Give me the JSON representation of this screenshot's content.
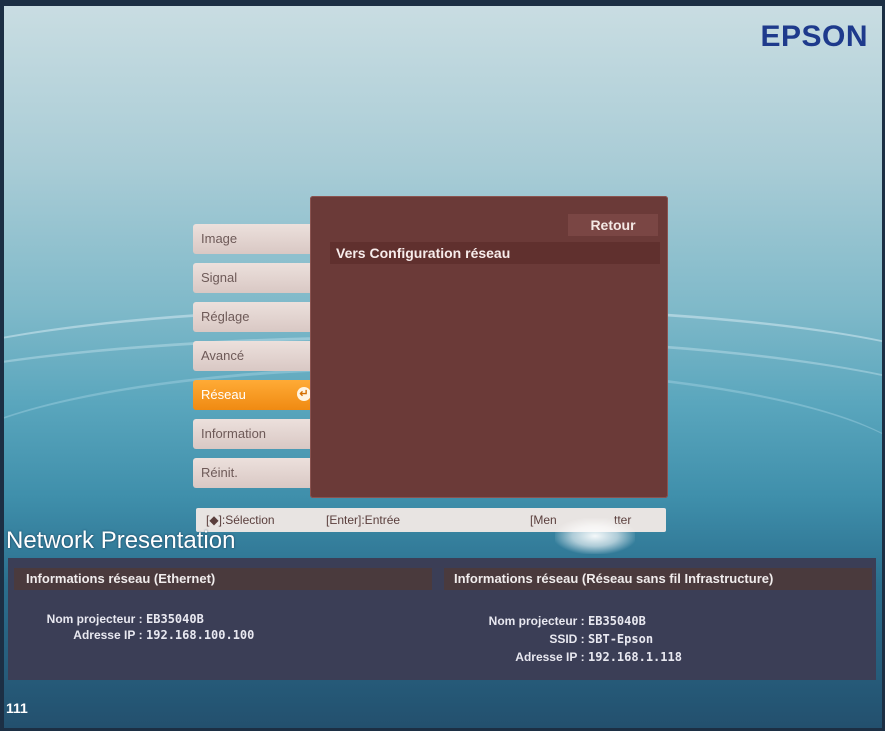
{
  "brand": "EPSON",
  "menu": {
    "tabs": [
      {
        "label": "Image"
      },
      {
        "label": "Signal"
      },
      {
        "label": "Réglage"
      },
      {
        "label": "Avancé"
      },
      {
        "label": "Réseau",
        "active": true
      },
      {
        "label": "Information"
      },
      {
        "label": "Réinit."
      }
    ],
    "panel": {
      "return_label": "Retour",
      "item_label": "Vers Configuration réseau"
    },
    "hints": {
      "select": "[◆]:Sélection",
      "enter": "[Enter]:Entrée",
      "menu": "[Men",
      "quit": "tter"
    }
  },
  "network": {
    "title": "Network Presentation",
    "ethernet": {
      "heading": "Informations réseau (Ethernet)",
      "rows": [
        {
          "label": "Nom projecteur",
          "value": "EB35040B"
        },
        {
          "label": "Adresse IP",
          "value": "192.168.100.100"
        }
      ]
    },
    "wireless": {
      "heading": "Informations réseau (Réseau sans fil Infrastructure)",
      "rows": [
        {
          "label": "Nom projecteur",
          "value": "EB35040B"
        },
        {
          "label": "SSID",
          "value": "SBT-Epson"
        },
        {
          "label": "Adresse IP",
          "value": "192.168.1.118"
        }
      ]
    }
  },
  "page_number": "111",
  "colors": {
    "accent_tab": "#f08a12",
    "panel_bg": "#6b3a38",
    "brand": "#1e3a8c"
  }
}
